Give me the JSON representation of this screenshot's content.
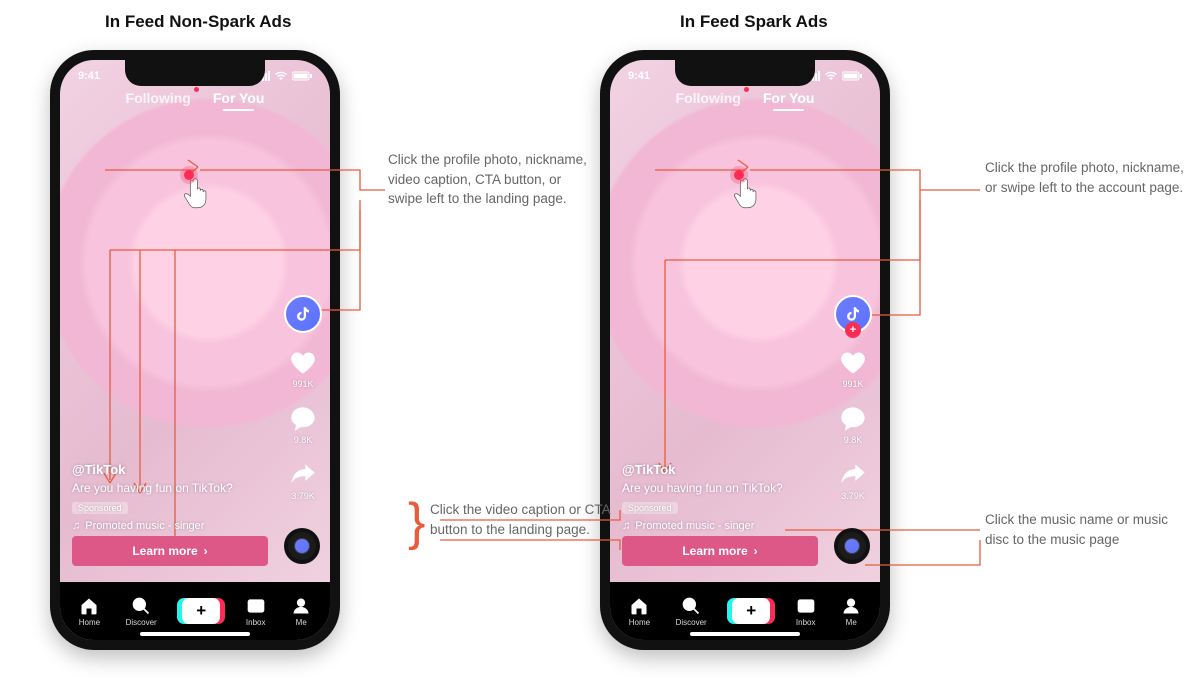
{
  "titles": {
    "left": "In Feed Non-Spark Ads",
    "right": "In Feed Spark Ads"
  },
  "status": {
    "time": "9:41"
  },
  "tabs": {
    "following": "Following",
    "foryou": "For You"
  },
  "sidebar": {
    "like_count": "991K",
    "comment_count": "9.8K",
    "share_count": "3.79K"
  },
  "caption": {
    "handle": "@TikTok",
    "text": "Are you having fun on TikTok?",
    "sponsored": "Sponsored",
    "music_prefix": "♫",
    "music": "Promoted music - singer"
  },
  "cta": {
    "label": "Learn more",
    "chevron": "›"
  },
  "bottom_nav": {
    "home": "Home",
    "discover": "Discover",
    "inbox": "Inbox",
    "me": "Me"
  },
  "annotations": {
    "left_top": "Click the profile photo, nickname, video caption, CTA button, or swipe left to the landing page.",
    "right_top": "Click the profile photo, nickname, or swipe left to the account page.",
    "right_bottom_left": "Click the video caption or CTA button to the landing page.",
    "right_bottom_right": "Click the music name or music disc to the music page"
  }
}
